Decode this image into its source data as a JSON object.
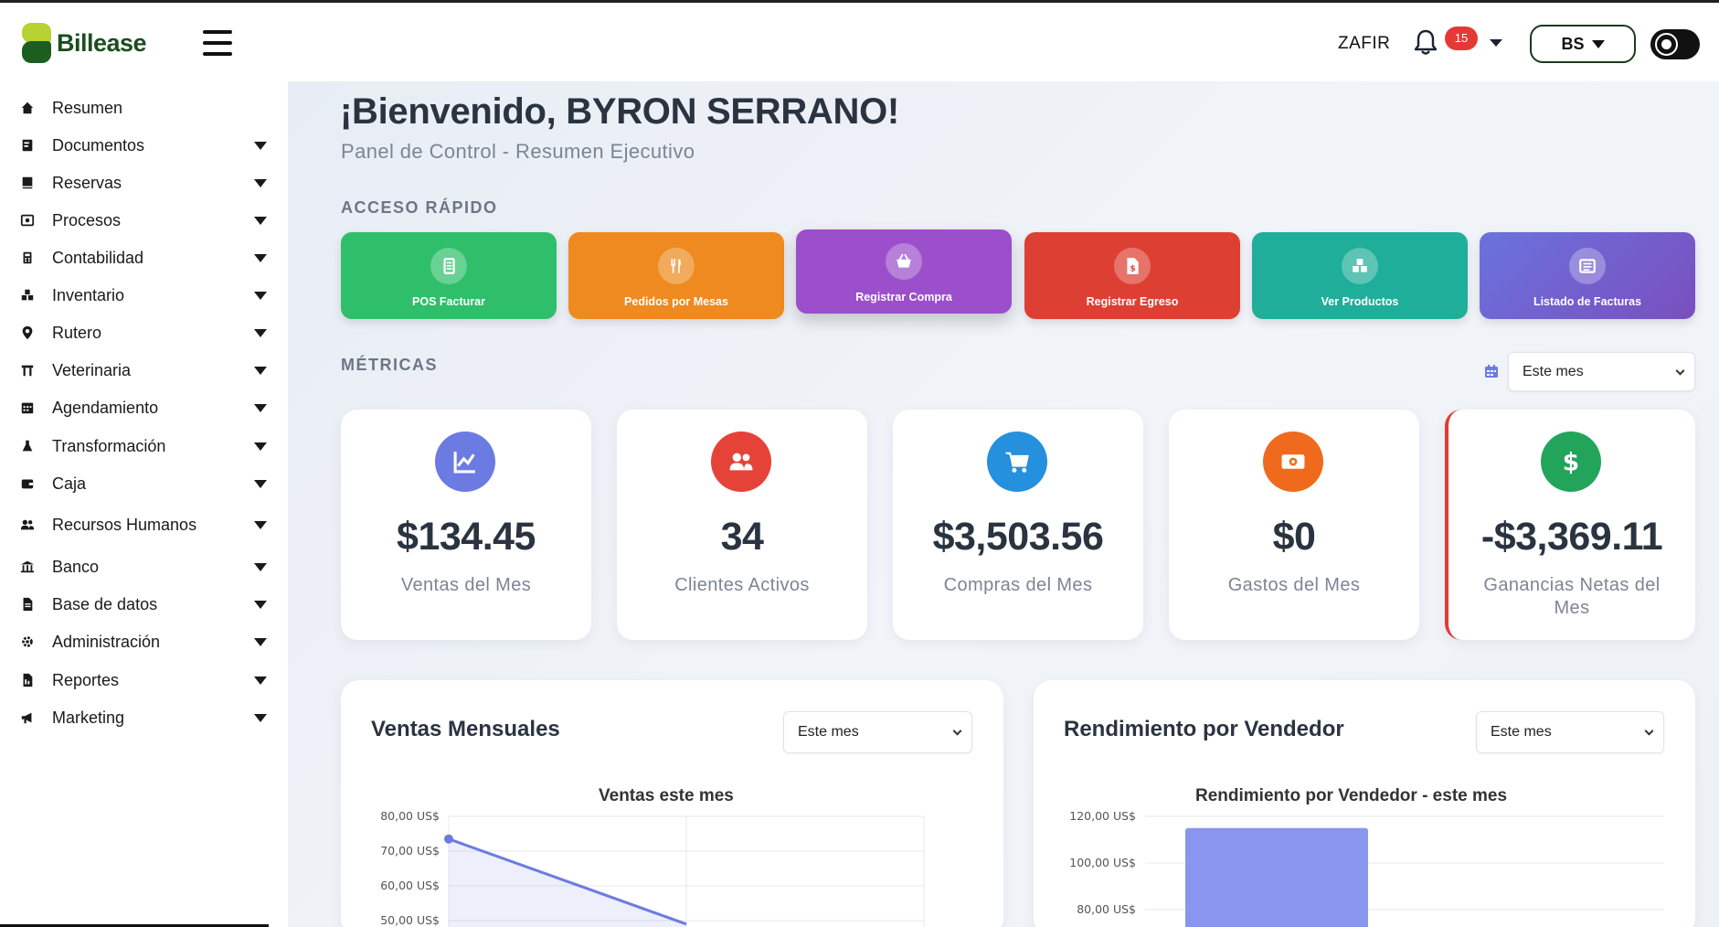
{
  "brand": {
    "name": "Billease"
  },
  "header": {
    "company": "ZAFIR",
    "notifications_count": "15",
    "user_initials": "BS"
  },
  "sidebar": {
    "items": [
      {
        "label": "Resumen",
        "icon": "home-icon",
        "has_submenu": false
      },
      {
        "label": "Documentos",
        "icon": "document-icon",
        "has_submenu": true
      },
      {
        "label": "Reservas",
        "icon": "book-icon",
        "has_submenu": true
      },
      {
        "label": "Procesos",
        "icon": "cog-box-icon",
        "has_submenu": true
      },
      {
        "label": "Contabilidad",
        "icon": "calculator-icon",
        "has_submenu": true
      },
      {
        "label": "Inventario",
        "icon": "boxes-icon",
        "has_submenu": true
      },
      {
        "label": "Rutero",
        "icon": "map-pin-icon",
        "has_submenu": true
      },
      {
        "label": "Veterinaria",
        "icon": "torii-icon",
        "has_submenu": true
      },
      {
        "label": "Agendamiento",
        "icon": "calendar-icon",
        "has_submenu": true
      },
      {
        "label": "Transformación",
        "icon": "flask-icon",
        "has_submenu": true
      },
      {
        "label": "Caja",
        "icon": "wallet-icon",
        "has_submenu": true
      },
      {
        "label": "Recursos Humanos",
        "icon": "users-icon",
        "has_submenu": true
      },
      {
        "label": "Banco",
        "icon": "bank-icon",
        "has_submenu": true
      },
      {
        "label": "Base de datos",
        "icon": "file-icon",
        "has_submenu": true
      },
      {
        "label": "Administración",
        "icon": "gear-icon",
        "has_submenu": true
      },
      {
        "label": "Reportes",
        "icon": "report-icon",
        "has_submenu": true
      },
      {
        "label": "Marketing",
        "icon": "megaphone-icon",
        "has_submenu": true
      }
    ]
  },
  "main": {
    "welcome": "¡Bienvenido, BYRON SERRANO!",
    "subtitle": "Panel de Control - Resumen Ejecutivo",
    "quick_access_label": "ACCESO RÁPIDO",
    "quick_actions": [
      {
        "label": "POS Facturar",
        "color": "#2fbf6a",
        "icon": "receipt-icon"
      },
      {
        "label": "Pedidos por Mesas",
        "color": "#ee8a1f",
        "icon": "utensils-icon"
      },
      {
        "label": "Registrar Compra",
        "color": "#9b4fcb",
        "icon": "basket-icon"
      },
      {
        "label": "Registrar Egreso",
        "color": "#de3f33",
        "icon": "money-file-icon"
      },
      {
        "label": "Ver Productos",
        "color": "#1fae9a",
        "icon": "boxes-icon"
      },
      {
        "label": "Listado de Facturas",
        "color": "#6a6fd8",
        "icon": "list-icon"
      }
    ],
    "metrics_label": "MÉTRICAS",
    "metrics_range": "Este mes",
    "metrics": [
      {
        "value": "$134.45",
        "label": "Ventas del Mes",
        "color": "#6c7be2",
        "icon": "chart-line-icon"
      },
      {
        "value": "34",
        "label": "Clientes Activos",
        "color": "#e64338",
        "icon": "users-icon"
      },
      {
        "value": "$3,503.56",
        "label": "Compras del Mes",
        "color": "#2590dd",
        "icon": "cart-icon"
      },
      {
        "value": "$0",
        "label": "Gastos del Mes",
        "color": "#f06a1d",
        "icon": "cash-icon"
      },
      {
        "value": "-$3,369.11",
        "label": "Ganancias Netas del Mes",
        "color": "#22a55a",
        "icon": "dollar-icon"
      }
    ]
  },
  "panels": {
    "sales": {
      "title": "Ventas Mensuales",
      "range": "Este mes",
      "chart_title": "Ventas este mes"
    },
    "sellers": {
      "title": "Rendimiento por Vendedor",
      "range": "Este mes",
      "chart_title": "Rendimiento por Vendedor - este mes"
    }
  },
  "chart_data": [
    {
      "type": "area",
      "title": "Ventas este mes",
      "y_ticks": [
        "80,00 US$",
        "70,00 US$",
        "60,00 US$",
        "50,00 US$"
      ],
      "ylim": [
        50,
        80
      ],
      "series": [
        {
          "values": [
            73.5,
            49
          ]
        }
      ],
      "color": "#6c7be2"
    },
    {
      "type": "bar",
      "title": "Rendimiento por Vendedor - este mes",
      "y_ticks": [
        "120,00 US$",
        "100,00 US$",
        "80,00 US$"
      ],
      "ylim": [
        80,
        120
      ],
      "values": [
        115
      ],
      "color": "#8896ee"
    }
  ]
}
